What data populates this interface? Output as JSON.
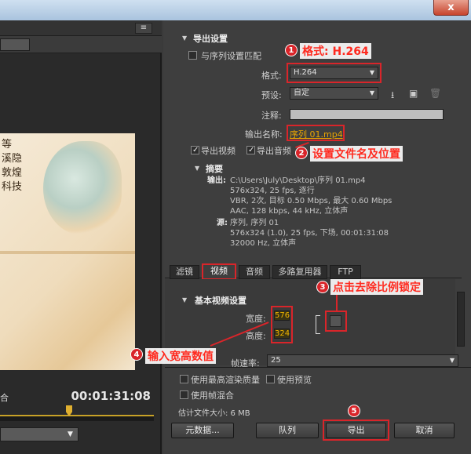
{
  "window": {
    "close_label": "x"
  },
  "left": {
    "menu_icon": "≡",
    "calligraphy": [
      "等",
      "溪隐",
      "敦煌",
      "科技"
    ],
    "timecode": "00:01:31:08",
    "label_fragment": "合"
  },
  "export_settings": {
    "title": "导出设置",
    "match_sequence_label": "与序列设置匹配",
    "format_label": "格式:",
    "format_value": "H.264",
    "preset_label": "预设:",
    "preset_value": "自定",
    "comment_label": "注释:",
    "output_name_label": "输出名称:",
    "output_name_value": "序列 01.mp4",
    "export_video_label": "导出视频",
    "export_audio_label": "导出音频"
  },
  "summary": {
    "title": "摘要",
    "output_label": "输出:",
    "output_lines": [
      "C:\\Users\\July\\Desktop\\序列 01.mp4",
      "576x324, 25 fps, 逐行",
      "VBR, 2次, 目标 0.50 Mbps, 最大 0.60 Mbps",
      "AAC, 128 kbps, 44 kHz, 立体声"
    ],
    "source_label": "源:",
    "source_lines": [
      "序列, 序列 01",
      "576x324 (1.0), 25 fps, 下场, 00:01:31:08",
      "32000 Hz, 立体声"
    ]
  },
  "tabs": [
    "滤镜",
    "视频",
    "音频",
    "多路复用器",
    "FTP"
  ],
  "video": {
    "section_title": "基本视频设置",
    "width_label": "宽度:",
    "width_value": "576",
    "height_label": "高度:",
    "height_value": "324",
    "framerate_label": "帧速率:",
    "framerate_value": "25"
  },
  "bottom": {
    "max_quality_label": "使用最高渲染质量",
    "use_preview_label": "使用预览",
    "frame_blend_label": "使用帧混合",
    "filesize_label": "估计文件大小: 6 MB",
    "metadata_button": "元数据...",
    "queue_button": "队列",
    "export_button": "导出",
    "cancel_button": "取消"
  },
  "annotations": {
    "a1": "格式: H.264",
    "a2": "设置文件名及位置",
    "a3": "点击去除比例锁定",
    "a4": "输入宽高数值",
    "n1": "1",
    "n2": "2",
    "n3": "3",
    "n4": "4",
    "n5": "5"
  },
  "colors": {
    "accent_annotation": "#d9252a",
    "value_orange": "#e8a400"
  }
}
